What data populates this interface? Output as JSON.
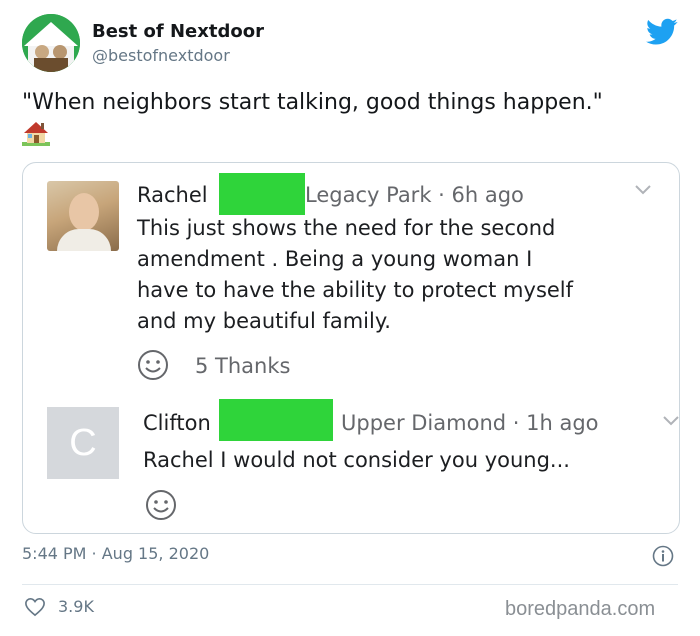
{
  "tweet": {
    "author_name": "Best of Nextdoor",
    "author_handle": "@bestofnextdoor",
    "text": "\"When neighbors start talking, good things happen.\"",
    "timestamp": "5:44 PM · Aug 15, 2020",
    "likes": "3.9K",
    "brand_color": "#1da1f2"
  },
  "embed": {
    "comment1": {
      "author": "Rachel",
      "meta": "Legacy Park · 6h ago",
      "body_lines": [
        "This just shows the need for the second",
        "amendment . Being a young woman I",
        "have to have the ability to protect myself",
        "and my beautiful family."
      ],
      "thanks": "5 Thanks"
    },
    "comment2": {
      "author": "Clifton",
      "avatar_letter": "C",
      "meta": "Upper Diamond · 1h ago",
      "body": "Rachel I would not consider you young..."
    },
    "redaction_color": "#2fd43a"
  },
  "watermark": "boredpanda.com",
  "icons": [
    "twitter-bird-icon",
    "house-icon",
    "chevron-down-icon",
    "smiley-icon",
    "info-icon",
    "heart-icon"
  ]
}
